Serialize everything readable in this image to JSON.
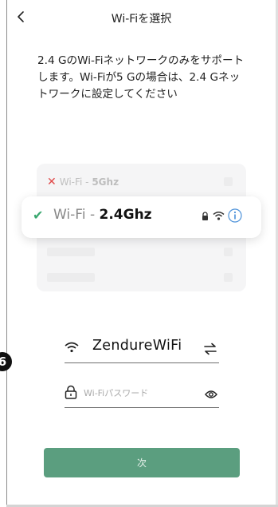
{
  "header": {
    "title": "Wi-Fiを選択",
    "back_icon": "chevron-left-icon"
  },
  "description": "2.4 GのWi-Fiネットワークのみをサポートします。Wi-Fiが5 Gの場合は、2.4 Gネットワークに設定してください",
  "illustration": {
    "unsupported_prefix": "Wi-Fi - ",
    "unsupported_band": "5Ghz",
    "supported_prefix": "Wi-Fi - ",
    "supported_band": "2.4Ghz",
    "colors": {
      "check": "#3aa76f",
      "cross": "#e04747",
      "info": "#4a90d9"
    }
  },
  "wifi": {
    "ssid": "ZendureWiFi",
    "icon": "wifi-icon",
    "switch_icon": "swap-icon"
  },
  "password": {
    "placeholder": "Wi-Fiパスワード",
    "value": "",
    "icon": "lock-icon",
    "toggle_icon": "eye-icon"
  },
  "next_button": {
    "label": "次",
    "color": "#5b9e7f"
  },
  "step_badge": "6"
}
